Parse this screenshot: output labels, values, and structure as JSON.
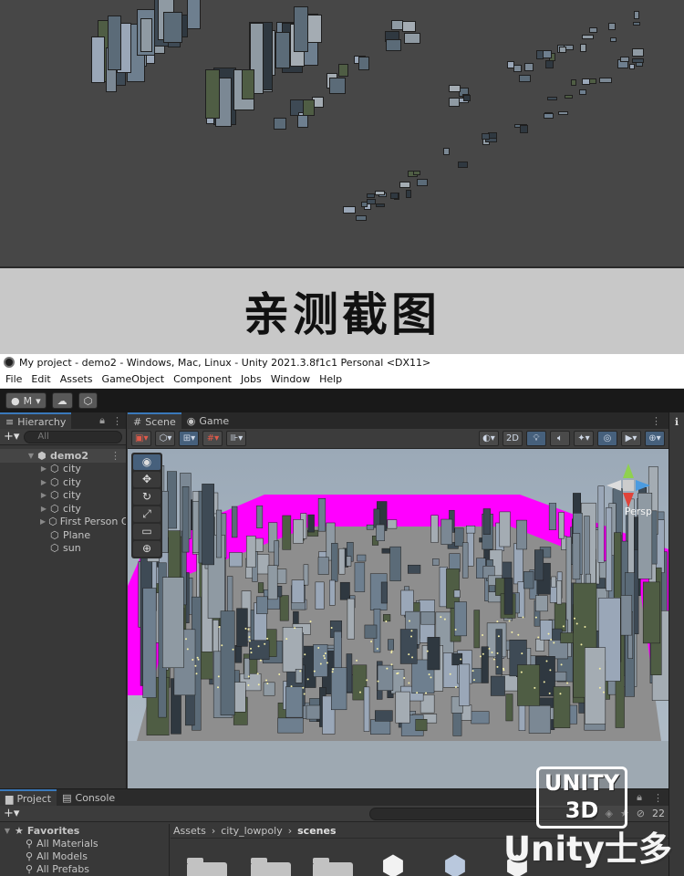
{
  "banner": {
    "title": "亲测截图"
  },
  "window": {
    "title": "My project - demo2 - Windows, Mac, Linux - Unity 2021.3.8f1c1 Personal <DX11>"
  },
  "menu": [
    "File",
    "Edit",
    "Assets",
    "GameObject",
    "Component",
    "Jobs",
    "Window",
    "Help"
  ],
  "toolbar": {
    "account_label": "M"
  },
  "hierarchy": {
    "tab_label": "Hierarchy",
    "search_placeholder": "All",
    "scene_name": "demo2",
    "items": [
      {
        "label": "city",
        "expandable": true
      },
      {
        "label": "city",
        "expandable": true
      },
      {
        "label": "city",
        "expandable": true
      },
      {
        "label": "city",
        "expandable": true
      },
      {
        "label": "First Person C",
        "expandable": true
      },
      {
        "label": "Plane",
        "expandable": false
      },
      {
        "label": "sun",
        "expandable": false
      }
    ]
  },
  "scene": {
    "tabs": [
      "Scene",
      "Game"
    ],
    "toggle_2d": "2D",
    "view_label": "Persp"
  },
  "project": {
    "tabs": [
      "Project",
      "Console"
    ],
    "favorites_label": "Favorites",
    "favorites": [
      "All Materials",
      "All Models",
      "All Prefabs"
    ],
    "breadcrumb": [
      "Assets",
      "city_lowpoly",
      "scenes"
    ],
    "hidden_count": "22"
  },
  "watermark": {
    "line1": "UNITY",
    "line2": "3D",
    "brand": "Unity士多"
  },
  "colors": {
    "magenta_plane": "#ff00ff",
    "accent": "#3a79bb",
    "editor_bg": "#383838"
  }
}
